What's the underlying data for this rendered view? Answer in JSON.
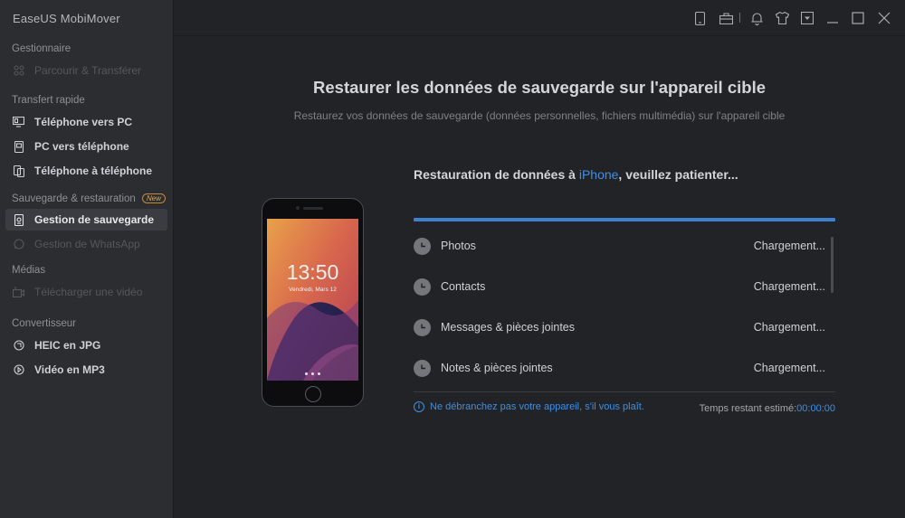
{
  "app": {
    "title": "EaseUS MobiMover"
  },
  "sidebar": {
    "sections": [
      {
        "label": "Gestionnaire",
        "items": [
          {
            "label": "Parcourir & Transférer",
            "icon": "grid-icon",
            "disabled": true
          }
        ]
      },
      {
        "label": "Transfert rapide",
        "items": [
          {
            "label": "Téléphone vers PC",
            "icon": "phone-to-pc-icon"
          },
          {
            "label": "PC vers téléphone",
            "icon": "pc-to-phone-icon"
          },
          {
            "label": "Téléphone à téléphone",
            "icon": "phone-to-phone-icon"
          }
        ]
      },
      {
        "label": "Sauvegarde & restauration",
        "badge": "New",
        "items": [
          {
            "label": "Gestion de sauvegarde",
            "icon": "backup-icon",
            "active": true
          },
          {
            "label": "Gestion de WhatsApp",
            "icon": "whatsapp-icon",
            "disabled": true
          }
        ]
      },
      {
        "label": "Médias",
        "items": [
          {
            "label": "Télécharger une vidéo",
            "icon": "video-download-icon",
            "disabled": true
          }
        ]
      },
      {
        "label": "Convertisseur",
        "items": [
          {
            "label": "HEIC en JPG",
            "icon": "convert-icon"
          },
          {
            "label": "Vidéo en MP3",
            "icon": "convert-icon"
          }
        ]
      }
    ]
  },
  "titlebar": {
    "icons": [
      "device-icon",
      "toolbox-icon",
      "bell-icon",
      "shirt-icon",
      "dropdown-icon",
      "minimize-icon",
      "maximize-icon",
      "close-icon"
    ]
  },
  "main": {
    "title": "Restaurer les données de sauvegarde sur l'appareil cible",
    "subtitle": "Restaurez vos données de sauvegarde (données personnelles, fichiers multimédia) sur l'appareil cible"
  },
  "phone": {
    "time": "13:50",
    "date": "Vendredi, Mars 12"
  },
  "restore": {
    "status_prefix": "Restauration de données à ",
    "device": "iPhone",
    "status_suffix": ", veuillez patienter...",
    "progress": 1.0,
    "items": [
      {
        "name": "Photos",
        "state": "Chargement..."
      },
      {
        "name": "Contacts",
        "state": "Chargement..."
      },
      {
        "name": "Messages & pièces jointes",
        "state": "Chargement..."
      },
      {
        "name": "Notes & pièces jointes",
        "state": "Chargement..."
      }
    ],
    "notice": "Ne débranchez pas votre appareil, s'il vous plaît.",
    "time_label": "Temps restant estimé:",
    "time_value": "00:00:00"
  },
  "colors": {
    "accent": "#3d8fe6",
    "badge": "#e0a44e",
    "background": "#222326",
    "sidebar": "#2b2d31"
  }
}
